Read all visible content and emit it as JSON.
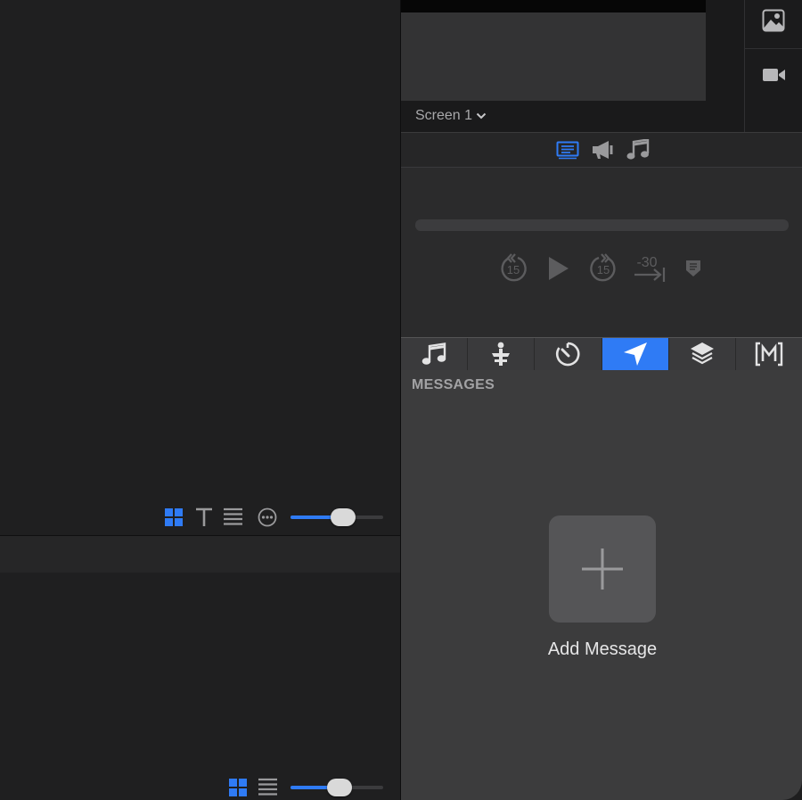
{
  "screen_selector": {
    "label": "Screen 1"
  },
  "media_buttons": [
    "image-icon",
    "video-camera-icon"
  ],
  "output_modes": [
    {
      "icon": "slides-icon",
      "active": true
    },
    {
      "icon": "megaphone-icon",
      "active": false
    },
    {
      "icon": "music-note-icon",
      "active": false
    }
  ],
  "transport": {
    "controls": [
      "skip-back-15-icon",
      "play-icon",
      "skip-forward-15-icon",
      "jump-30-icon",
      "marker-icon"
    ],
    "skip_back_label": "15",
    "skip_forward_label": "15",
    "jump_label": "-30"
  },
  "library_tabs": [
    {
      "icon": "music-note-icon",
      "active": false
    },
    {
      "icon": "props-icon",
      "active": false
    },
    {
      "icon": "timer-icon",
      "active": false
    },
    {
      "icon": "messages-send-icon",
      "active": true
    },
    {
      "icon": "layers-icon",
      "active": false
    },
    {
      "icon": "macros-icon",
      "active": false
    }
  ],
  "messages": {
    "header": "MESSAGES",
    "add_label": "Add Message"
  },
  "left_top_toolbar": {
    "views": [
      "grid-view-icon",
      "text-view-icon",
      "list-view-icon",
      "more-options-icon"
    ],
    "zoom_level": 0.58
  },
  "left_bottom_toolbar": {
    "views": [
      "grid-view-icon",
      "list-view-icon"
    ],
    "zoom_level": 0.53
  },
  "colors": {
    "accent": "#2f7bf5",
    "background": "#1e1e1f",
    "panel": "#3c3c3d"
  }
}
